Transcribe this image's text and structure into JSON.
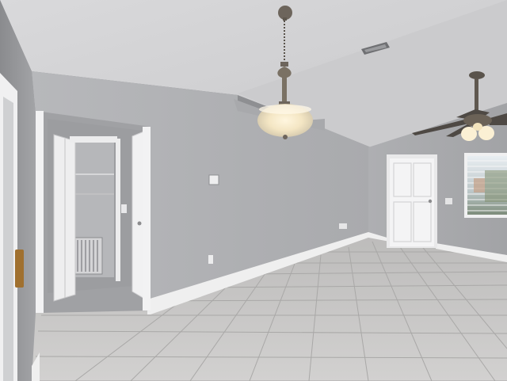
{
  "scene": {
    "kind": "photo",
    "subject": "interior-room",
    "colors": {
      "ceiling": "#d4d4d6",
      "wall_light": "#b9babd",
      "wall_mid": "#a6a7aa",
      "wall_dark": "#8f9093",
      "floor_tile": "#c8c7c6",
      "grout": "#a9a8a7",
      "trim": "#efefef",
      "door": "#f2f2f2",
      "lamp_glow": "#fff3d8",
      "metal": "#6d655c"
    },
    "icons": [
      "pendant-light-icon",
      "ceiling-fan-icon",
      "thermostat-icon",
      "air-vent-icon"
    ]
  }
}
